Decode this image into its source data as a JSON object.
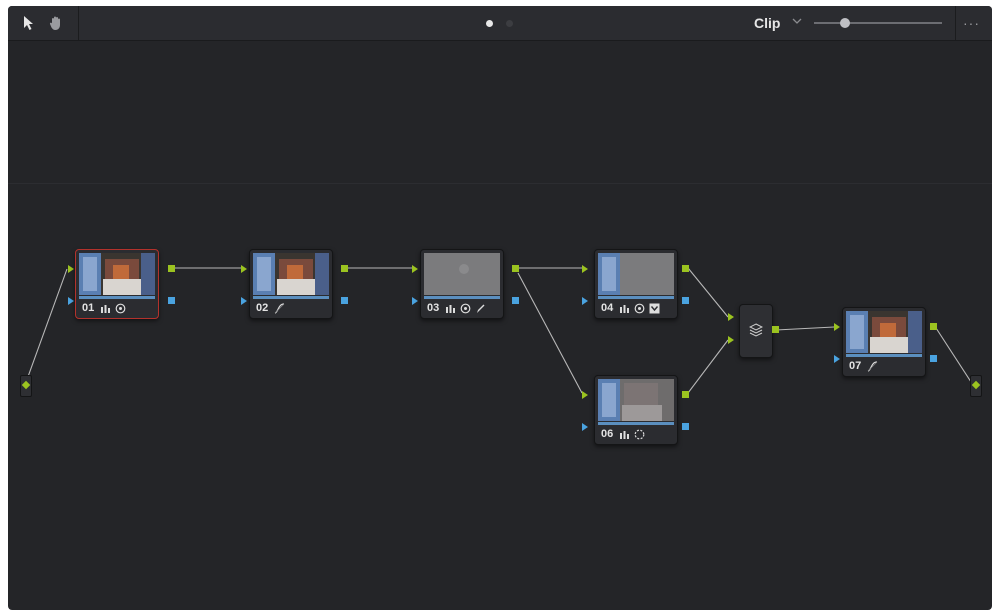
{
  "toolbar": {
    "pointer_tool_icon": "arrow-pointer-icon",
    "hand_tool_icon": "hand-icon",
    "page_indicator": {
      "count": 2,
      "active": 0
    },
    "mode_label": "Clip",
    "zoom_level": 0.22,
    "more_label": "···"
  },
  "nodes": [
    {
      "id": "01",
      "number": "01",
      "tools": [
        "qualifier-icon",
        "circle-window-icon"
      ],
      "selected": true,
      "thumb": "color"
    },
    {
      "id": "02",
      "number": "02",
      "tools": [
        "curves-icon"
      ],
      "selected": false,
      "thumb": "color"
    },
    {
      "id": "03",
      "number": "03",
      "tools": [
        "qualifier-icon",
        "circle-window-icon",
        "pen-icon"
      ],
      "selected": false,
      "thumb": "gray"
    },
    {
      "id": "04",
      "number": "04",
      "tools": [
        "qualifier-icon",
        "circle-window-icon",
        "key-output-icon"
      ],
      "selected": false,
      "thumb": "half-gray"
    },
    {
      "id": "06",
      "number": "06",
      "tools": [
        "qualifier-icon",
        "dotted-circle-icon"
      ],
      "selected": false,
      "thumb": "blur"
    },
    {
      "id": "07",
      "number": "07",
      "tools": [
        "curves-icon"
      ],
      "selected": false,
      "thumb": "color"
    }
  ],
  "layer_mixer": {
    "icon": "layers-icon"
  },
  "colors": {
    "background": "#242528",
    "rgb_port": "#9bc320",
    "key_port": "#4aa3e0",
    "selected_border": "#b3322c",
    "connection": "#b8b8b8"
  }
}
